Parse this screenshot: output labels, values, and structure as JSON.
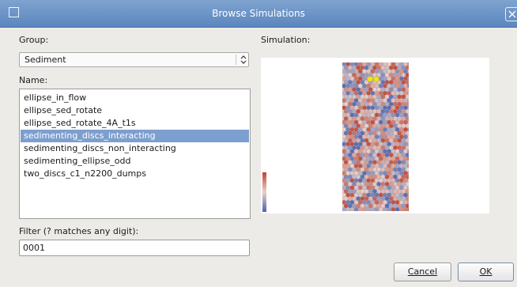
{
  "window": {
    "title": "Browse Simulations",
    "icons": {
      "window": "window-square-icon",
      "close": "close-x-icon"
    }
  },
  "group": {
    "label": "Group:",
    "selected": "Sediment",
    "arrow_icon": "updown-arrows-icon"
  },
  "name": {
    "label": "Name:",
    "items": [
      "ellipse_in_flow",
      "ellipse_sed_rotate",
      "ellipse_sed_rotate_4A_t1s",
      "sedimenting_discs_interacting",
      "sedimenting_discs_non_interacting",
      "sedimenting_ellipse_odd",
      "two_discs_c1_n2200_dumps"
    ],
    "selected_index": 3
  },
  "filter": {
    "label": "Filter (? matches any digit):",
    "value": "0001"
  },
  "simulation": {
    "label": "Simulation:",
    "colormap": {
      "high": "#c2412f",
      "mid": "#e9d2cb",
      "low": "#4a63b3"
    },
    "highlight_color": "#f2e21a"
  },
  "buttons": {
    "cancel": "Cancel",
    "ok": "OK"
  },
  "colors": {
    "titlebar": "#6c94c7",
    "selection": "#7d9fcf",
    "background": "#ecebe8"
  }
}
